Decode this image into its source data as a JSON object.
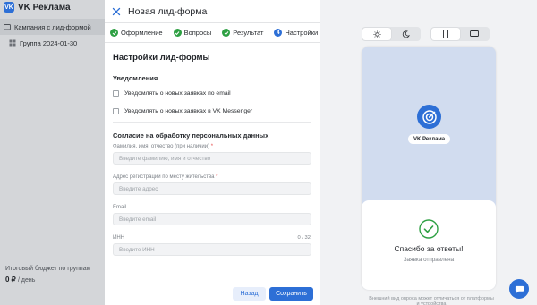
{
  "background_app": {
    "brand_name": "VK Реклама",
    "campaign_item": "Кампания с лид-формой",
    "group_item": "Группа 2024-01-30",
    "budget_label": "Итоговый бюджет по группам",
    "budget_value": "0 ₽",
    "budget_unit": "/ день"
  },
  "modal": {
    "title": "Новая лид-форма",
    "steps": [
      {
        "label": "Оформление",
        "state": "done"
      },
      {
        "label": "Вопросы",
        "state": "done"
      },
      {
        "label": "Результат",
        "state": "done"
      },
      {
        "label": "Настройки",
        "state": "current",
        "number": "4"
      }
    ],
    "form": {
      "title": "Настройки лид-формы",
      "notifications": {
        "heading": "Уведомления",
        "options": [
          {
            "label": "Уведомлять о новых заявках по email",
            "checked": false
          },
          {
            "label": "Уведомлять о новых заявках в VK Messenger",
            "checked": false
          }
        ]
      },
      "consent": {
        "heading": "Согласие на обработку персональных данных",
        "fields": [
          {
            "label": "Фамилия, имя, отчество (при наличии)",
            "required": "*",
            "placeholder": "Введите фамилию, имя и отчество"
          },
          {
            "label": "Адрес регистрации по месту жительства",
            "required": "*",
            "placeholder": "Введите адрес"
          },
          {
            "label": "Email",
            "required": "",
            "placeholder": "Введите email"
          },
          {
            "label": "ИНН",
            "required": "",
            "placeholder": "Введите ИНН",
            "counter": "0 / 32"
          }
        ]
      }
    },
    "footer": {
      "back_label": "Назад",
      "save_label": "Сохранить"
    }
  },
  "preview": {
    "theme_options": [
      "light",
      "dark"
    ],
    "selected_theme": "light",
    "device_options": [
      "mobile",
      "desktop"
    ],
    "selected_device": "mobile",
    "profile_name": "VK Реклама",
    "thanks_title": "Спасибо за ответы!",
    "thanks_subtitle": "Заявка отправлена",
    "note": "Внешний вид опроса может отличаться от платформы и устройства"
  },
  "colors": {
    "accent": "#2d6fd6",
    "success": "#2ea043",
    "required": "#e64646"
  }
}
